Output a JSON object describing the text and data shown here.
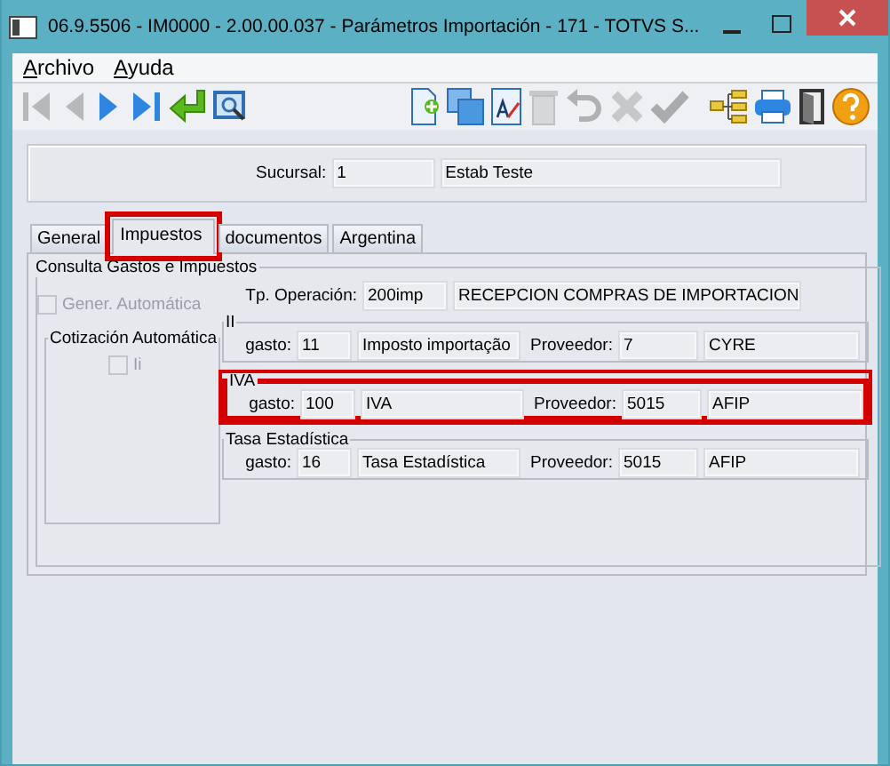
{
  "window": {
    "title": "06.9.5506 - IM0000 - 2.00.00.037 - Parámetros Importación - 171 - TOTVS S..."
  },
  "menu": [
    {
      "label": "Archivo"
    },
    {
      "label": "Ayuda"
    }
  ],
  "toolbar": [
    [
      {
        "kind": "first",
        "disabled": true
      },
      {
        "kind": "previous",
        "disabled": true
      },
      {
        "kind": "next",
        "disabled": false
      },
      {
        "kind": "last",
        "disabled": false
      },
      {
        "kind": "enter",
        "disabled": false
      },
      {
        "kind": "zoom",
        "disabled": false
      }
    ],
    [
      {
        "kind": "new",
        "disabled": false
      },
      {
        "kind": "copy",
        "disabled": false
      },
      {
        "kind": "edit",
        "disabled": false
      },
      {
        "kind": "delete",
        "disabled": true
      },
      {
        "kind": "undo",
        "disabled": true
      },
      {
        "kind": "cancel",
        "disabled": true
      },
      {
        "kind": "confirm",
        "disabled": true
      }
    ],
    [
      {
        "kind": "tree",
        "disabled": false
      },
      {
        "kind": "print",
        "disabled": false
      },
      {
        "kind": "exit",
        "disabled": false
      },
      {
        "kind": "help",
        "disabled": false
      }
    ]
  ],
  "sucursal": {
    "label": "Sucursal:",
    "code": "1",
    "name": "Estab Teste"
  },
  "tabs": [
    {
      "label": "General",
      "selected": false,
      "highlighted": false
    },
    {
      "label": "Impuestos",
      "selected": true,
      "highlighted": true
    },
    {
      "label": "documentos",
      "selected": false,
      "highlighted": false
    },
    {
      "label": "Argentina",
      "selected": false,
      "highlighted": false
    }
  ],
  "panel": {
    "title": "Consulta Gastos e Impuestos",
    "options": [
      {
        "label": "Gener. Automática",
        "checked": false,
        "disabled": true
      }
    ],
    "cotizacion": {
      "title": "Cotización Automática",
      "options": [
        {
          "label": "Ii",
          "checked": false,
          "disabled": true
        }
      ]
    },
    "operation": {
      "label": "Tp. Operación:",
      "code": "200imp",
      "name": "RECEPCION COMPRAS DE IMPORTACION"
    },
    "taxes": [
      {
        "title": "II",
        "highlighted": false,
        "expense_label": "gasto:",
        "expense_code": "11",
        "expense_name": "Imposto importação",
        "supplier_label": "Proveedor:",
        "supplier_code": "7",
        "supplier_name": "CYRE"
      },
      {
        "title": "IVA",
        "highlighted": true,
        "expense_label": "gasto:",
        "expense_code": "100",
        "expense_name": "IVA",
        "supplier_label": "Proveedor:",
        "supplier_code": "5015",
        "supplier_name": "AFIP"
      },
      {
        "title": "Tasa Estadística",
        "highlighted": false,
        "expense_label": "gasto:",
        "expense_code": "16",
        "expense_name": "Tasa Estadística",
        "supplier_label": "Proveedor:",
        "supplier_code": "5015",
        "supplier_name": "AFIP"
      }
    ]
  }
}
